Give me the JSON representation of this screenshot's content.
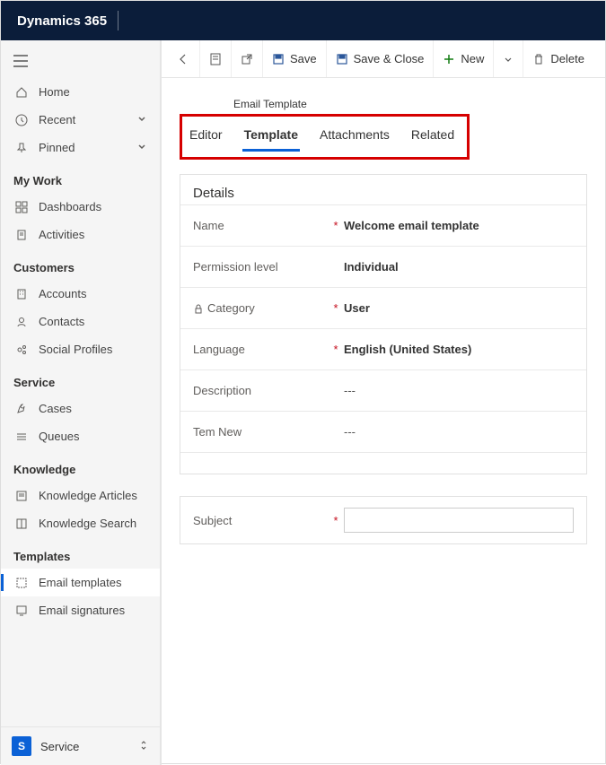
{
  "app_title": "Dynamics 365",
  "sidebar": {
    "home": "Home",
    "recent": "Recent",
    "pinned": "Pinned",
    "sections": {
      "mywork": {
        "title": "My Work",
        "dashboards": "Dashboards",
        "activities": "Activities"
      },
      "customers": {
        "title": "Customers",
        "accounts": "Accounts",
        "contacts": "Contacts",
        "social": "Social Profiles"
      },
      "service": {
        "title": "Service",
        "cases": "Cases",
        "queues": "Queues"
      },
      "knowledge": {
        "title": "Knowledge",
        "articles": "Knowledge Articles",
        "search": "Knowledge Search"
      },
      "templates": {
        "title": "Templates",
        "email": "Email templates",
        "signatures": "Email signatures"
      }
    },
    "footer": {
      "badge": "S",
      "label": "Service"
    }
  },
  "cmdbar": {
    "save": "Save",
    "saveclose": "Save & Close",
    "new": "New",
    "delete": "Delete"
  },
  "entity": "Email Template",
  "tabs": {
    "editor": "Editor",
    "template": "Template",
    "attachments": "Attachments",
    "related": "Related"
  },
  "details": {
    "title": "Details",
    "fields": {
      "name": {
        "label": "Name",
        "value": "Welcome email template",
        "required": true
      },
      "permission": {
        "label": "Permission level",
        "value": "Individual",
        "required": false
      },
      "category": {
        "label": "Category",
        "value": "User",
        "required": true,
        "locked": true
      },
      "language": {
        "label": "Language",
        "value": "English (United States)",
        "required": true
      },
      "description": {
        "label": "Description",
        "value": "---",
        "required": false
      },
      "temnew": {
        "label": "Tem New",
        "value": "---",
        "required": false
      }
    }
  },
  "subject": {
    "label": "Subject",
    "required": true,
    "value": ""
  }
}
